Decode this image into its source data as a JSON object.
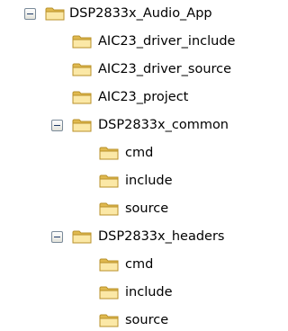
{
  "tree": {
    "root": {
      "label": "DSP2833x_Audio_App",
      "expanded": true,
      "children": [
        {
          "label": "AIC23_driver_include"
        },
        {
          "label": "AIC23_driver_source"
        },
        {
          "label": "AIC23_project"
        },
        {
          "label": "DSP2833x_common",
          "expanded": true,
          "children": [
            {
              "label": "cmd"
            },
            {
              "label": "include"
            },
            {
              "label": "source"
            }
          ]
        },
        {
          "label": "DSP2833x_headers",
          "expanded": true,
          "children": [
            {
              "label": "cmd"
            },
            {
              "label": "include"
            },
            {
              "label": "source"
            }
          ]
        }
      ]
    },
    "icons": {
      "folder": "folder-icon",
      "collapse": "collapse-minus-icon"
    },
    "colors": {
      "folder_light": "#fbe8a6",
      "folder_dark": "#e0b94f",
      "folder_outline": "#b8912a",
      "expander_border": "#7a8a99"
    }
  }
}
